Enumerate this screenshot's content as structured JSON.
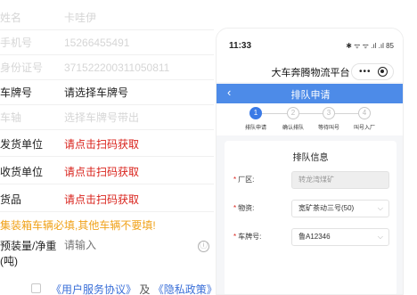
{
  "left_form": {
    "rows": [
      {
        "label": "姓名",
        "value": "卡哇伊"
      },
      {
        "label": "手机号",
        "value": "15266455491"
      },
      {
        "label": "身份证号",
        "value": "371522200311050811"
      },
      {
        "label": "车牌号",
        "value": "请选择车牌号"
      },
      {
        "label": "车轴",
        "value": "选择车牌号带出"
      },
      {
        "label": "发货单位",
        "value": "请点击扫码获取"
      },
      {
        "label": "收货单位",
        "value": "请点击扫码获取"
      },
      {
        "label": "货品",
        "value": "请点击扫码获取"
      }
    ],
    "notice": "集装箱车辆必填,其他车辆不要填!",
    "weight_label_line1": "预装量/净重",
    "weight_label_line2": "(吨)",
    "weight_placeholder": "请输入",
    "info_icon": "ⓘ",
    "agreement_link1": "《用户服务协议》",
    "agreement_and": "及",
    "agreement_link2": "《隐私政策》"
  },
  "phone": {
    "status_time": "11:33",
    "status_icons": "✱ ᯤ ᯤ .ıl .ıl 85",
    "app_title": "大车奔腾物流平台",
    "capsule_more": "•••",
    "header_back": "‹",
    "header_title": "排队申请",
    "steps": [
      {
        "num": "1",
        "label": "排队申请"
      },
      {
        "num": "2",
        "label": "确认排队"
      },
      {
        "num": "3",
        "label": "等待叫号"
      },
      {
        "num": "4",
        "label": "叫号入厂"
      }
    ],
    "card_title": "排队信息",
    "fields": [
      {
        "label": "厂区:",
        "value": "转龙湾煤矿"
      },
      {
        "label": "物资:",
        "value": "宽矿茶动三号(50)"
      },
      {
        "label": "车牌号:",
        "value": "鲁A12346"
      }
    ],
    "required_mark": "*",
    "chevron": "⌵"
  },
  "colors": {
    "primary_blue": "#4d8be8",
    "required_red": "#d9231c",
    "warning_orange": "#f0a21a",
    "link_blue": "#3a6fd8"
  }
}
